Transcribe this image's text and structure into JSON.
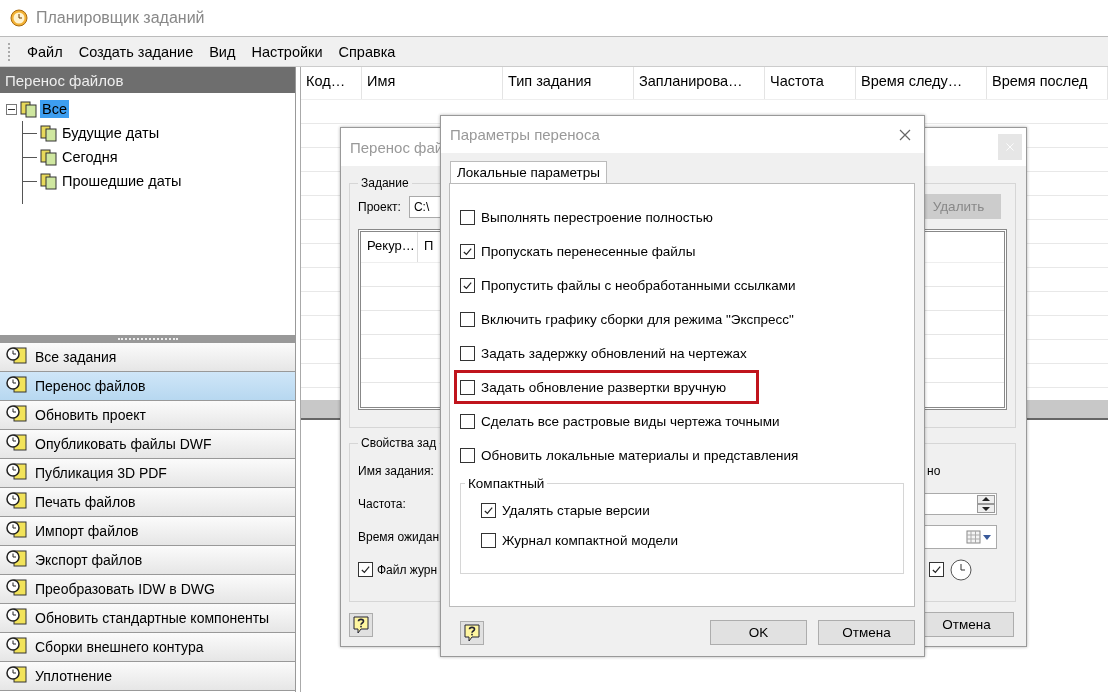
{
  "window": {
    "title": "Планировщик заданий"
  },
  "menu": [
    {
      "label": "Файл"
    },
    {
      "label": "Создать задание"
    },
    {
      "label": "Вид"
    },
    {
      "label": "Настройки"
    },
    {
      "label": "Справка"
    }
  ],
  "left_panel": {
    "title": "Перенос файлов",
    "tree": [
      {
        "label": "Все",
        "selected": true,
        "expanded": true,
        "children": [
          {
            "label": "Будущие даты",
            "selected": false
          },
          {
            "label": "Сегодня",
            "selected": false
          },
          {
            "label": "Прошедшие даты",
            "selected": false
          }
        ]
      }
    ]
  },
  "task_types": [
    {
      "label": "Все задания",
      "selected": false
    },
    {
      "label": "Перенос файлов",
      "selected": true
    },
    {
      "label": "Обновить проект",
      "selected": false
    },
    {
      "label": "Опубликовать файлы DWF",
      "selected": false
    },
    {
      "label": "Публикация 3D PDF",
      "selected": false
    },
    {
      "label": "Печать файлов",
      "selected": false
    },
    {
      "label": "Импорт файлов",
      "selected": false
    },
    {
      "label": "Экспорт файлов",
      "selected": false
    },
    {
      "label": "Преобразовать IDW в DWG",
      "selected": false
    },
    {
      "label": "Обновить стандартные компоненты",
      "selected": false
    },
    {
      "label": "Сборки внешнего контура",
      "selected": false
    },
    {
      "label": "Уплотнение",
      "selected": false
    }
  ],
  "table": {
    "columns": [
      "Код…",
      "Имя",
      "Тип задания",
      "Запланирова…",
      "Частота",
      "Время следу…",
      "Время послед"
    ]
  },
  "back_dialog": {
    "title": "Перенос фай",
    "task_group": {
      "title": "Задание",
      "project_label": "Проект:",
      "project_value": "C:\\",
      "delete_button": {
        "label": "Удалить",
        "disabled": true
      },
      "list_columns": [
        "Рекур…",
        "П"
      ]
    },
    "properties_group": {
      "title": "Свойства зад",
      "labels": [
        "Имя задания:",
        "Частота:",
        "Время ожидан"
      ],
      "log_checkbox": {
        "label": "Файл журн",
        "checked": true
      },
      "right_label": "но",
      "clock_checkbox": {
        "checked": true
      }
    },
    "cancel_button": "Отмена"
  },
  "dialog": {
    "title": "Параметры переноса",
    "tabs": [
      {
        "label": "Локальные параметры",
        "selected": true
      }
    ],
    "options": [
      {
        "label": "Выполнять перестроение полностью",
        "checked": false,
        "highlighted": false
      },
      {
        "label": "Пропускать перенесенные файлы",
        "checked": true,
        "highlighted": false
      },
      {
        "label": "Пропустить файлы с необработанными ссылками",
        "checked": true,
        "highlighted": false
      },
      {
        "label": "Включить графику сборки для режима \"Экспресс\"",
        "checked": false,
        "highlighted": false
      },
      {
        "label": "Задать задержку обновлений на чертежах",
        "checked": false,
        "highlighted": false
      },
      {
        "label": "Задать обновление развертки вручную",
        "checked": false,
        "highlighted": true
      },
      {
        "label": "Сделать все растровые виды чертежа точными",
        "checked": false,
        "highlighted": false
      },
      {
        "label": "Обновить локальные материалы и представления",
        "checked": false,
        "highlighted": false
      }
    ],
    "compact_group": {
      "title": "Компактный",
      "options": [
        {
          "label": "Удалять старые версии",
          "checked": true
        },
        {
          "label": "Журнал компактной модели",
          "checked": false
        }
      ]
    },
    "ok_button": "OK",
    "cancel_button": "Отмена"
  }
}
